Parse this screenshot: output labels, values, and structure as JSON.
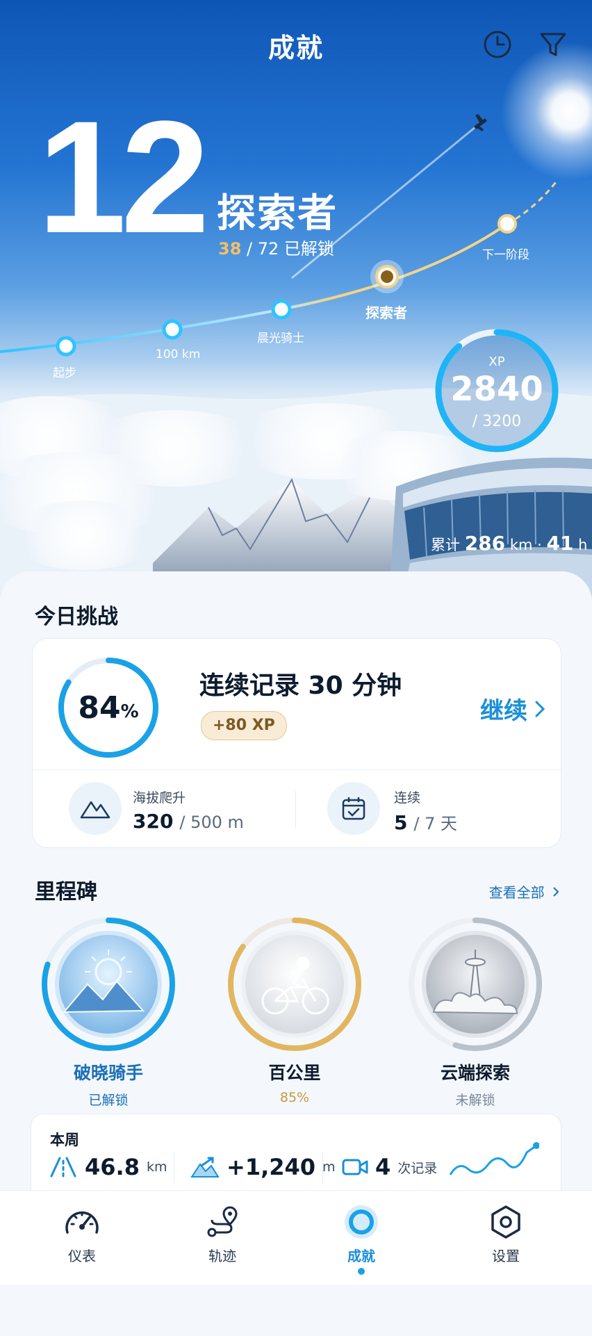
{
  "header": {
    "title": "成就"
  },
  "level": {
    "number": "12",
    "rank_name": "探索者",
    "unlocked_count": "38",
    "unlocked_total": "/ 72 已解锁"
  },
  "path": {
    "stages": [
      {
        "label": "起步"
      },
      {
        "label": "100 km"
      },
      {
        "label": "晨光骑士"
      },
      {
        "label": "探索者"
      },
      {
        "label": "下一阶段"
      }
    ]
  },
  "xp": {
    "label": "XP",
    "value": "2840",
    "total": "/ 3200",
    "progress": 0.8875
  },
  "cumulative": {
    "prefix": "累计",
    "distance": "286",
    "distance_unit": "km",
    "separator": "·",
    "hours": "41",
    "hours_unit": "h"
  },
  "today": {
    "section_title": "今日挑战",
    "progress_value": "84",
    "progress_unit": "%",
    "progress": 0.84,
    "challenge_title": "连续记录 30 分钟",
    "xp_reward": "+80 XP",
    "continue_label": "继续",
    "stats": [
      {
        "label": "海拔爬升",
        "value": "320",
        "rest": "/ 500 m",
        "icon": "mountain-icon"
      },
      {
        "label": "连续",
        "value": "5",
        "rest": "/ 7 天",
        "icon": "calendar-check-icon"
      }
    ]
  },
  "milestones": {
    "section_title": "里程碑",
    "view_all": "查看全部",
    "items": [
      {
        "name": "破晓骑手",
        "status": "已解锁",
        "progress": 0.8,
        "color": "#1aa1e6",
        "name_color": "#1a6fb8",
        "status_color": "#1a6fb8"
      },
      {
        "name": "百公里",
        "status": "85%",
        "progress": 0.85,
        "color": "#e2b660",
        "name_color": "#0d1b2e",
        "status_color": "#c89a3c"
      },
      {
        "name": "云端探索",
        "status": "未解锁",
        "progress": 0.55,
        "color": "#b9c1cb",
        "name_color": "#0d1b2e",
        "status_color": "#7a8696"
      }
    ]
  },
  "week": {
    "title": "本周",
    "distance_value": "46.8",
    "distance_unit": "km",
    "climb_value": "+1,240",
    "climb_unit": "m",
    "records_value": "4",
    "records_unit": "次记录"
  },
  "tabs": [
    {
      "label": "仪表",
      "icon": "speedometer-icon"
    },
    {
      "label": "轨迹",
      "icon": "route-icon"
    },
    {
      "label": "成就",
      "icon": "achievement-icon"
    },
    {
      "label": "设置",
      "icon": "settings-icon"
    }
  ],
  "colors": {
    "accent": "#1a8fd8",
    "gold": "#e2b660"
  }
}
